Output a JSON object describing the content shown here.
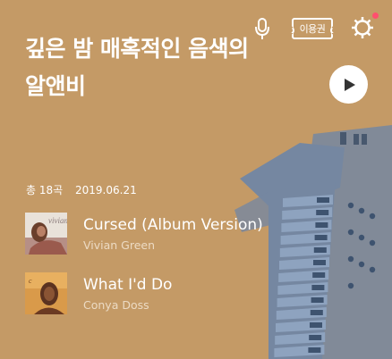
{
  "header": {
    "voice_icon": "microphone-icon",
    "pass_label": "이용권",
    "settings_icon": "gear-icon",
    "has_notification": true
  },
  "album": {
    "title_line1": "깊은 밤 매혹적인 음색의",
    "title_line2": "알앤비",
    "play_icon": "play-icon",
    "track_count": "총 18곡",
    "date": "2019.06.21"
  },
  "tracks": [
    {
      "title": "Cursed (Album Version)",
      "artist": "Vivian Green",
      "art_text": "vivian"
    },
    {
      "title": "What I'd Do",
      "artist": "Conya Doss",
      "art_text": ""
    }
  ],
  "colors": {
    "background": "#c49a66",
    "art_blue": "#6f86a6",
    "accent_dot": "#ff4f6e"
  }
}
